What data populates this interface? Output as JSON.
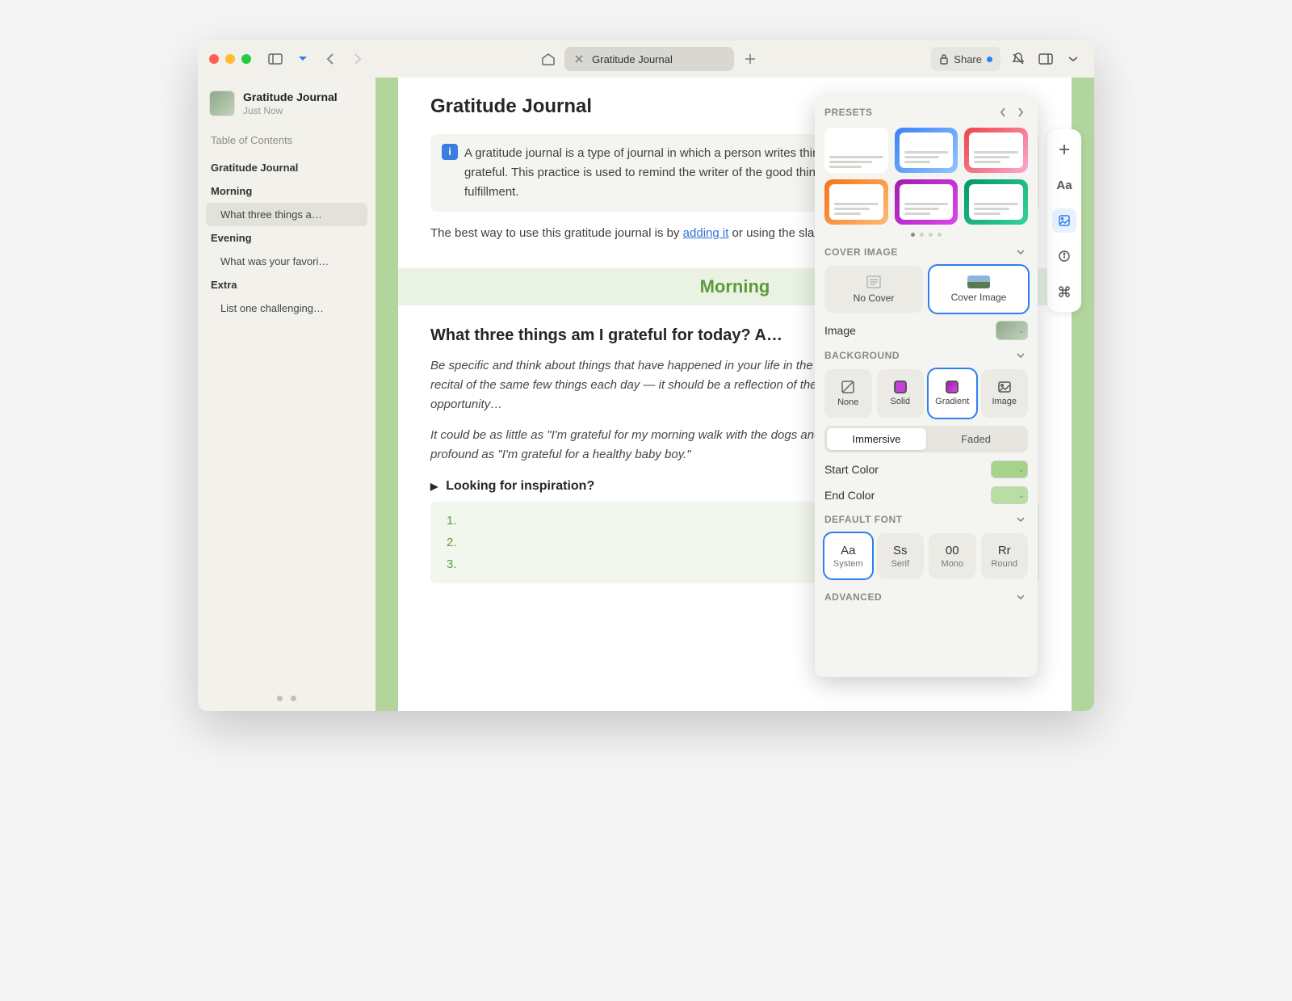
{
  "toolbar": {
    "tab_title": "Gratitude Journal",
    "share_label": "Share"
  },
  "sidebar": {
    "doc_title": "Gratitude Journal",
    "doc_time": "Just Now",
    "toc_label": "Table of Contents",
    "items": [
      {
        "label": "Gratitude Journal",
        "level": 1,
        "selected": false
      },
      {
        "label": "Morning",
        "level": 1,
        "selected": false
      },
      {
        "label": "What three things a…",
        "level": 2,
        "selected": true
      },
      {
        "label": "Evening",
        "level": 1,
        "selected": false
      },
      {
        "label": "What was your favori…",
        "level": 2,
        "selected": false
      },
      {
        "label": "Extra",
        "level": 1,
        "selected": false
      },
      {
        "label": "List one challenging…",
        "level": 2,
        "selected": false
      }
    ]
  },
  "page": {
    "h1": "Gratitude Journal",
    "callout": "A gratitude journal is a type of journal in which a person writes things for which they are thankful or grateful. This practice is used to remind the writer of the good things in their life and to increase fulfillment.",
    "para2_a": "The best way to use this gratitude journal is by ",
    "para2_link": "adding it",
    "para2_b": " or using the slash command (\"/\").",
    "section_title": "Morning",
    "h2": "What three things am I grateful for today? A…",
    "italic1": "Be specific and think about things that have happened in your life in the past few weeks. This shouldn't be a recital of the same few things each day — it should be a reflection of the things going on your life and an opportunity…",
    "italic2": "It could be as little as \"I'm grateful for my morning walk with the dogs and the crisp cold autumn sunrise\" or as profound as \"I'm grateful for a healthy baby boy.\"",
    "disclosure": "Looking for inspiration?",
    "list": [
      "1.",
      "2.",
      "3."
    ]
  },
  "panel": {
    "presets_label": "PRESETS",
    "preset_colors": [
      {
        "bg": "#ffffff",
        "framed": false
      },
      {
        "bg": "linear-gradient(135deg,#3b82f6,#93c5fd)",
        "framed": true
      },
      {
        "bg": "linear-gradient(135deg,#ef4444,#f9a8d4)",
        "framed": true
      },
      {
        "bg": "linear-gradient(135deg,#f97316,#fdba74)",
        "framed": true
      },
      {
        "bg": "linear-gradient(135deg,#a21caf,#d946ef)",
        "framed": true
      },
      {
        "bg": "linear-gradient(135deg,#059669,#34d399)",
        "framed": true
      }
    ],
    "cover_label": "COVER IMAGE",
    "cover_options": {
      "none": "No Cover",
      "image": "Cover Image"
    },
    "image_label": "Image",
    "background_label": "BACKGROUND",
    "bg_options": {
      "none": "None",
      "solid": "Solid",
      "gradient": "Gradient",
      "image": "Image"
    },
    "bg_mode": {
      "immersive": "Immersive",
      "faded": "Faded"
    },
    "start_color_label": "Start Color",
    "end_color_label": "End Color",
    "start_color": "#a6d38a",
    "end_color": "#b9dea3",
    "font_label": "DEFAULT FONT",
    "fonts": [
      {
        "sample": "Aa",
        "label": "System",
        "selected": true
      },
      {
        "sample": "Ss",
        "label": "Serif",
        "selected": false
      },
      {
        "sample": "00",
        "label": "Mono",
        "selected": false
      },
      {
        "sample": "Rr",
        "label": "Round",
        "selected": false
      }
    ],
    "advanced_label": "ADVANCED"
  }
}
